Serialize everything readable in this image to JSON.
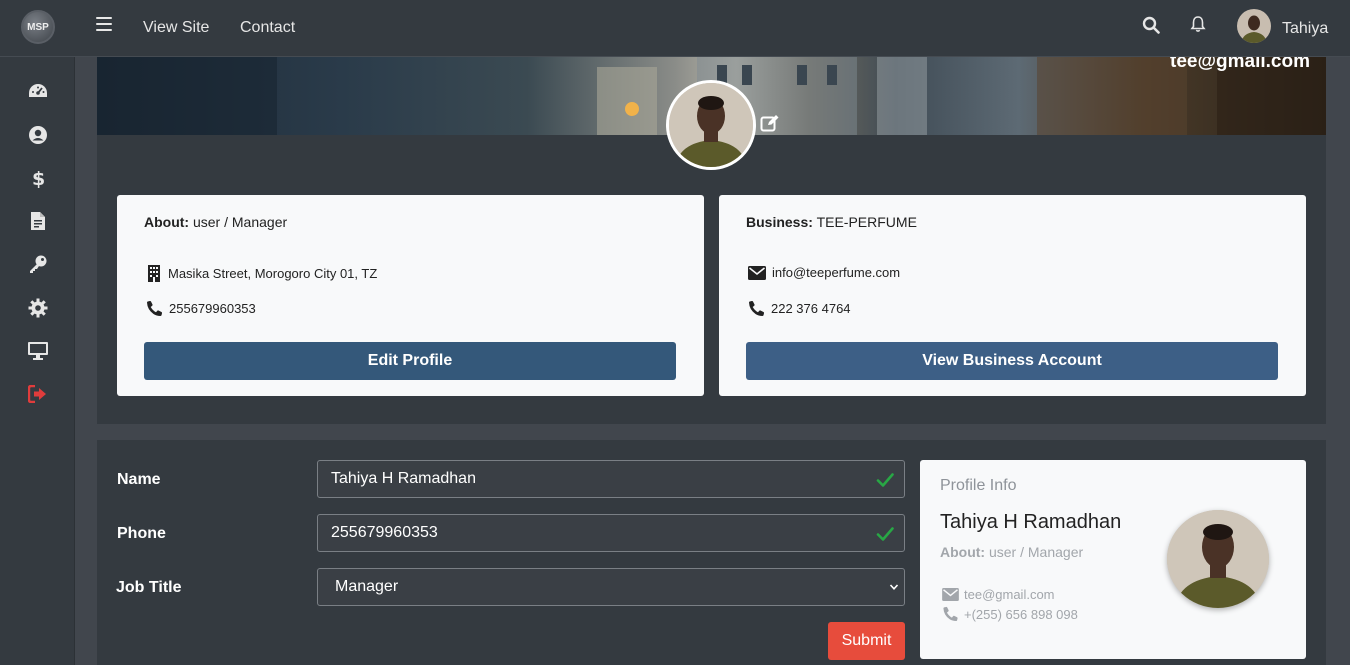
{
  "topbar": {
    "logo_text": "MSP",
    "links": [
      "View Site",
      "Contact"
    ],
    "username": "Tahiya"
  },
  "sidebar": {
    "icons": [
      "dashboard-icon",
      "user-icon",
      "dollar-icon",
      "file-icon",
      "key-icon",
      "gear-icon",
      "monitor-icon",
      "logout-icon"
    ]
  },
  "banner": {
    "email": "tee@gmail.com"
  },
  "cards": {
    "about": {
      "label": "About:",
      "value": "user / Manager",
      "address": "Masika Street, Morogoro City 01, TZ",
      "phone": "255679960353",
      "button": "Edit Profile"
    },
    "business": {
      "label": "Business:",
      "value": "TEE-PERFUME",
      "email": "info@teeperfume.com",
      "phone": "222 376 4764",
      "button": "View Business Account"
    }
  },
  "form": {
    "name_label": "Name",
    "name_value": "Tahiya H Ramadhan",
    "phone_label": "Phone",
    "phone_value": "255679960353",
    "job_label": "Job Title",
    "job_value": "Manager",
    "submit": "Submit"
  },
  "profile_info": {
    "heading": "Profile Info",
    "name": "Tahiya H Ramadhan",
    "about_label": "About:",
    "about_value": "user / Manager",
    "email": "tee@gmail.com",
    "phone": "+(255) 656 898 098"
  },
  "colors": {
    "primary_button": "#34587a",
    "submit_button": "#e74c3c",
    "logout_icon": "#e03c3c",
    "valid_check": "#28a745"
  }
}
